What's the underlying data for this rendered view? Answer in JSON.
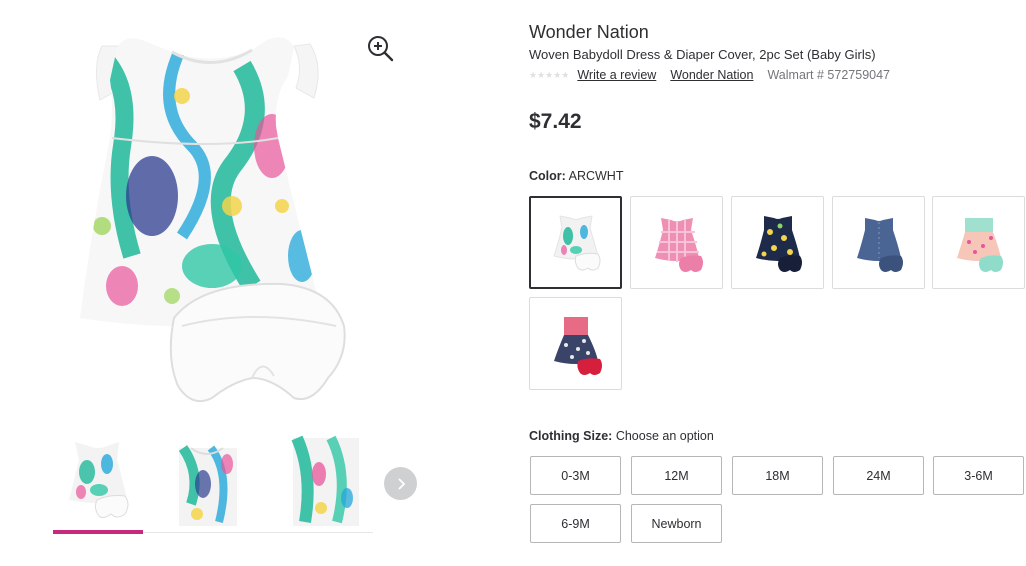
{
  "product": {
    "brand": "Wonder Nation",
    "title": "Woven Babydoll Dress & Diaper Cover, 2pc Set (Baby Girls)",
    "rating_stars": "★★★★★",
    "write_review": "Write a review",
    "brand_link": "Wonder Nation",
    "sku": "Walmart # 572759047",
    "price": "$7.42"
  },
  "gallery": {
    "zoom_icon": "zoom-in-icon",
    "next_icon": "chevron-right-icon",
    "thumbnail_count": 3,
    "active_thumbnail": 1
  },
  "color": {
    "label": "Color:",
    "value": "ARCWHT",
    "options": [
      {
        "name": "tropical-print-dress",
        "selected": true
      },
      {
        "name": "pink-gingham-dress",
        "selected": false
      },
      {
        "name": "navy-lemon-dress",
        "selected": false
      },
      {
        "name": "chambray-dress",
        "selected": false
      },
      {
        "name": "peach-floral-dress",
        "selected": false
      },
      {
        "name": "pink-navy-floral-dress",
        "selected": false
      }
    ]
  },
  "size": {
    "label": "Clothing Size:",
    "value": "Choose an option",
    "options": [
      "0-3M",
      "12M",
      "18M",
      "24M",
      "3-6M",
      "6-9M",
      "Newborn"
    ]
  },
  "colors": {
    "accent": "#c72a7d",
    "text": "#2e2f32",
    "muted": "#74767c"
  }
}
